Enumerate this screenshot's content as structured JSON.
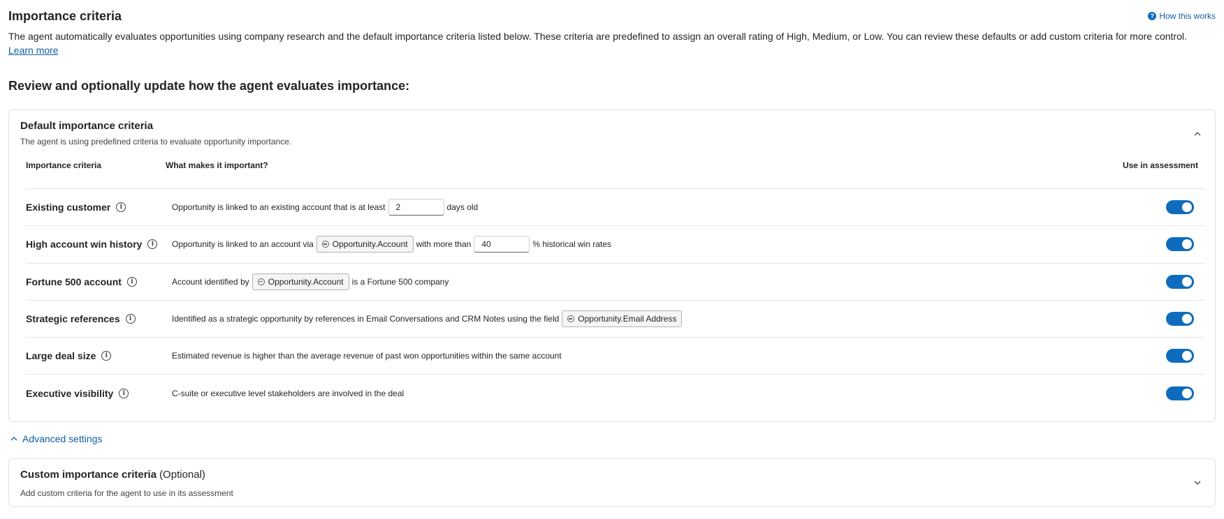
{
  "header": {
    "title": "Importance criteria",
    "how_link": "How this works",
    "intro": "The agent automatically evaluates opportunities using company research and the default importance criteria listed below. These criteria are predefined to assign an overall rating of High, Medium, or Low. You can review these defaults or add custom criteria for more control.",
    "learn_more": "Learn more"
  },
  "section_heading": "Review and optionally update how the agent evaluates importance:",
  "default_card": {
    "title": "Default importance criteria",
    "subtitle": "The agent is using predefined criteria to evaluate opportunity importance.",
    "columns": {
      "criteria": "Importance criteria",
      "what": "What makes it important?",
      "use": "Use in assessment"
    },
    "rows": [
      {
        "name": "Existing customer",
        "pre": "Opportunity is linked to an existing account that is at least",
        "input": "2",
        "post": "days old",
        "enabled": true
      },
      {
        "name": "High account win history",
        "pre": "Opportunity is linked to an account via",
        "token": "Opportunity.Account",
        "mid": "with more than",
        "input": "40",
        "post": "% historical win rates",
        "enabled": true
      },
      {
        "name": "Fortune 500 account",
        "pre": "Account identified by",
        "token": "Opportunity.Account",
        "post": "is a Fortune 500 company",
        "enabled": true
      },
      {
        "name": "Strategic references",
        "pre": "Identified as a strategic opportunity by references in Email Conversations and CRM Notes using the field",
        "token": "Opportunity.Email Address",
        "enabled": true
      },
      {
        "name": "Large deal size",
        "pre": "Estimated revenue is higher than the average revenue of past won opportunities within the same account",
        "enabled": true
      },
      {
        "name": "Executive visibility",
        "pre": "C-suite or executive level stakeholders are involved in the deal",
        "enabled": true
      }
    ]
  },
  "advanced_settings": "Advanced settings",
  "custom_card": {
    "title": "Custom importance criteria",
    "optional": "(Optional)",
    "subtitle": "Add custom criteria for the agent to use in its assessment"
  },
  "colors": {
    "accent": "#0f6cbd",
    "link": "#115ea3",
    "border": "#e0e0e0"
  }
}
